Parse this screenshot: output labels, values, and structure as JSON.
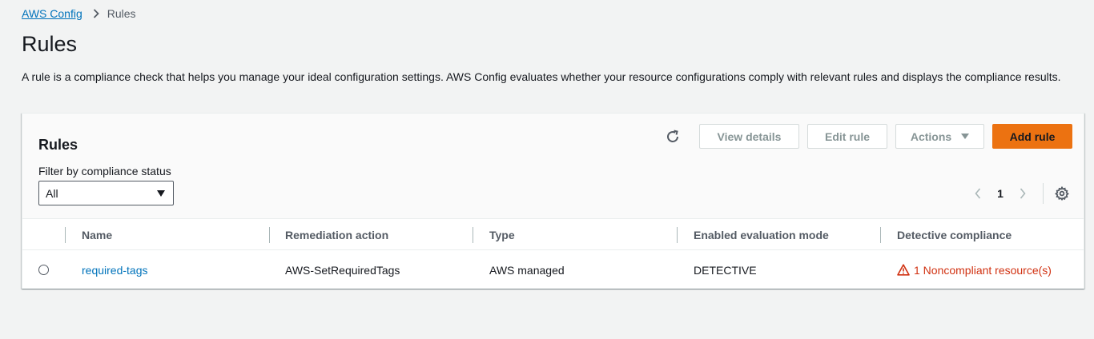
{
  "breadcrumb": {
    "root": "AWS Config",
    "current": "Rules"
  },
  "page": {
    "title": "Rules",
    "description": "A rule is a compliance check that helps you manage your ideal configuration settings. AWS Config evaluates whether your resource configurations comply with relevant rules and displays the compliance results."
  },
  "panel": {
    "title": "Rules",
    "toolbar": {
      "refresh_icon": "refresh-icon",
      "view_details": "View details",
      "edit_rule": "Edit rule",
      "actions": "Actions",
      "add_rule": "Add rule"
    },
    "filter": {
      "label": "Filter by compliance status",
      "value": "All"
    },
    "pagination": {
      "current_page": "1"
    },
    "settings_icon": "gear-icon"
  },
  "table": {
    "columns": [
      "Name",
      "Remediation action",
      "Type",
      "Enabled evaluation mode",
      "Detective compliance"
    ],
    "rows": [
      {
        "name": "required-tags",
        "remediation_action": "AWS-SetRequiredTags",
        "type": "AWS managed",
        "evaluation_mode": "DETECTIVE",
        "compliance": "1 Noncompliant resource(s)"
      }
    ]
  },
  "colors": {
    "link": "#0073bb",
    "primary_button": "#ec7211",
    "error": "#d13212",
    "background": "#f2f3f3"
  }
}
